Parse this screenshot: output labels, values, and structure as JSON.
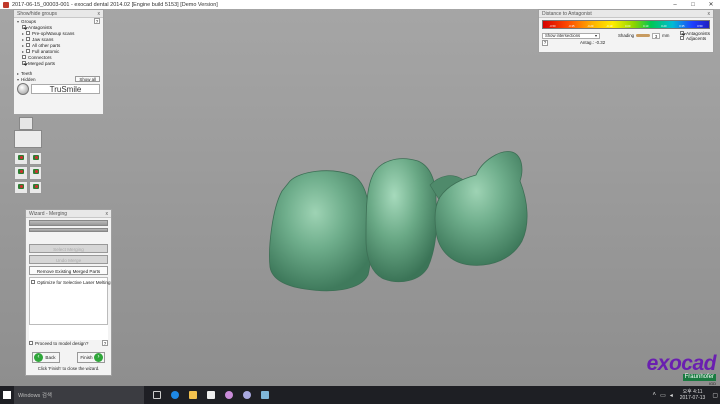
{
  "window": {
    "title": "2017-06-15_00003-001 - exocad dental 2014.02 [Engine build 5153] [Demo Version]",
    "minimize": "–",
    "maximize": "□",
    "close": "✕"
  },
  "groups_panel": {
    "header": "Show/hide groups",
    "close": "x",
    "help": "?",
    "groups_label": "Groups",
    "items": [
      {
        "label": "Antagonists",
        "checked": true
      },
      {
        "label": "Pre-op/Waxup scans",
        "checked": false
      },
      {
        "label": "Jaw scans",
        "checked": false
      },
      {
        "label": "All other parts",
        "checked": false
      },
      {
        "label": "Full anatomic",
        "checked": false
      },
      {
        "label": "Connectors",
        "checked": false
      },
      {
        "label": "Merged parts",
        "checked": true
      }
    ],
    "teeth_label": "Teeth",
    "hidden_label": "Hidden",
    "show_all": "Show all",
    "brand": "TruSmile"
  },
  "distance_panel": {
    "header": "Distance to Antagonist",
    "close": "x",
    "scale_labels": [
      "-0.50",
      "-0.35",
      "-0.20",
      "-0.10",
      "0.00",
      "0.10",
      "0.20",
      "0.35",
      "0.50"
    ],
    "show_intersections": "Show intersections",
    "shading_label": "Shading",
    "shading_value": "3",
    "units": "mm",
    "antag_label": "Antag.: -0.32",
    "antagonists_label": "Antagonists",
    "adjacents_label": "Adjacents",
    "help": "?"
  },
  "wizard": {
    "header": "Wizard - Merging",
    "close": "x",
    "buttons": [
      "Select Merging",
      "Undo Merge",
      "Remove Existing Merged Parts"
    ],
    "optimize_label": "Optimize for Selective Laser Melting",
    "proceed_label": "Proceed to model design?",
    "back": "Back",
    "finish": "Finish",
    "hint": "Click 'Finish' to close the wizard.",
    "help": "?"
  },
  "logo": {
    "name": "exocad",
    "partner": "Fraunhofer",
    "version": "IGD"
  },
  "taskbar": {
    "search_placeholder": "Windows 검색",
    "time": "오후 4:11",
    "date": "2017-07-13"
  }
}
